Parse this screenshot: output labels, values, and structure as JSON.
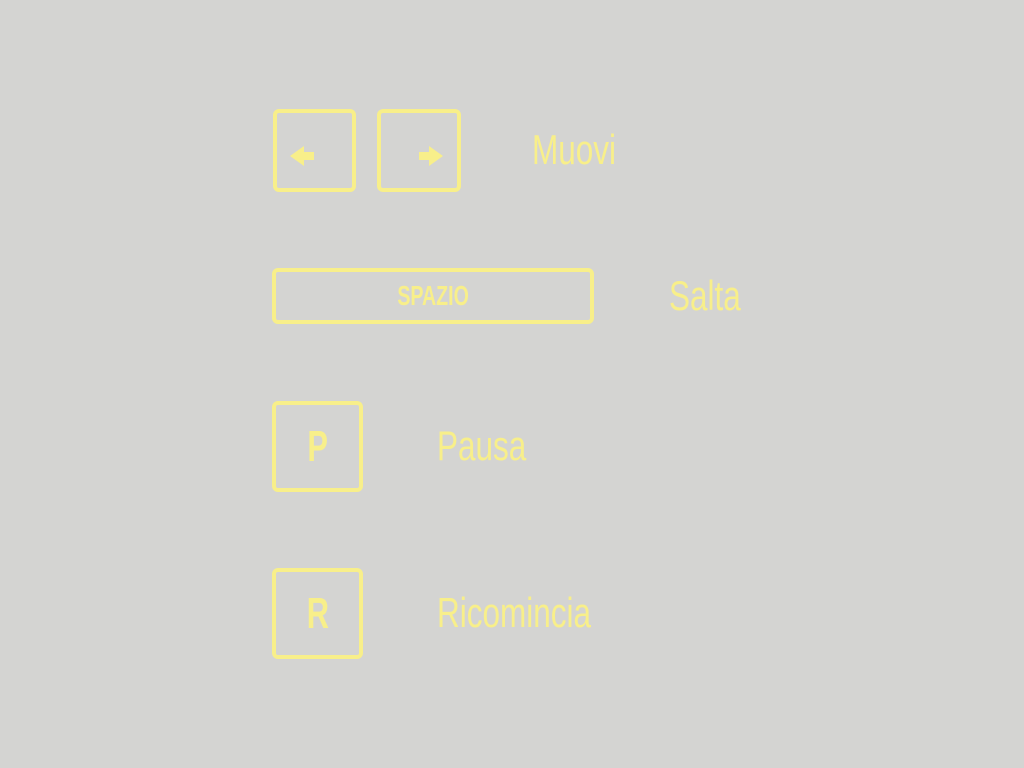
{
  "theme": {
    "background": "#d4d4d2",
    "accent": "#f8ef8a"
  },
  "controls": [
    {
      "keys": [
        {
          "icon": "arrow-left-icon"
        },
        {
          "icon": "arrow-right-icon"
        }
      ],
      "action": "Muovi"
    },
    {
      "key": "SPAZIO",
      "action": "Salta"
    },
    {
      "key": "P",
      "action": "Pausa"
    },
    {
      "key": "R",
      "action": "Ricomincia"
    }
  ]
}
